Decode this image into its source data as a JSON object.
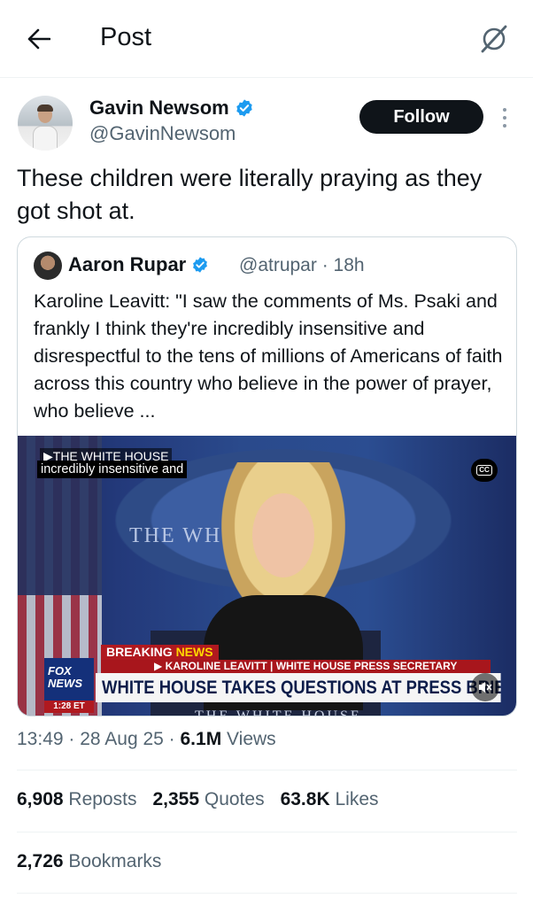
{
  "header": {
    "title": "Post"
  },
  "author": {
    "name": "Gavin Newsom",
    "handle": "@GavinNewsom",
    "verified": true,
    "follow_label": "Follow"
  },
  "tweet": {
    "text": "These children were literally praying as they got shot at."
  },
  "quote": {
    "name": "Aaron Rupar",
    "handle_time": "@atrupar · 18h",
    "verified": true,
    "text": "Karoline Leavitt: \"I saw the comments of Ms. Psaki and frankly I think they're incredibly insensitive and disrespectful to the tens of millions of Americans of faith across this country who believe in the power of prayer, who believe ...",
    "video": {
      "top_label": "▶THE WHITE HOUSE",
      "caption": "incredibly insensitive and",
      "cc_label": "CC",
      "seal_text": "THE WH          USE",
      "breaking_label": "BREAKING",
      "breaking_news": "NEWS",
      "subhead": "▶ KAROLINE LEAVITT | WHITE HOUSE PRESS SECRETARY",
      "chyron": "WHITE HOUSE TAKES QUESTIONS AT PRESS BRIEFING",
      "logo_line1": "FOX",
      "logo_line2": "NEWS",
      "logo_time": "1:28 ET",
      "footer_text": "THE WHITE HOUSE"
    }
  },
  "meta": {
    "time": "13:49",
    "date": "28 Aug 25",
    "views_count": "6.1M",
    "views_label": "Views"
  },
  "stats": [
    {
      "count": "6,908",
      "label": "Reposts"
    },
    {
      "count": "2,355",
      "label": "Quotes"
    },
    {
      "count": "63.8K",
      "label": "Likes"
    }
  ],
  "bookmarks": {
    "count": "2,726",
    "label": "Bookmarks"
  },
  "colors": {
    "verified": "#1d9bf0",
    "text": "#0f1419",
    "secondary": "#536471",
    "follow_bg": "#0f1419"
  }
}
